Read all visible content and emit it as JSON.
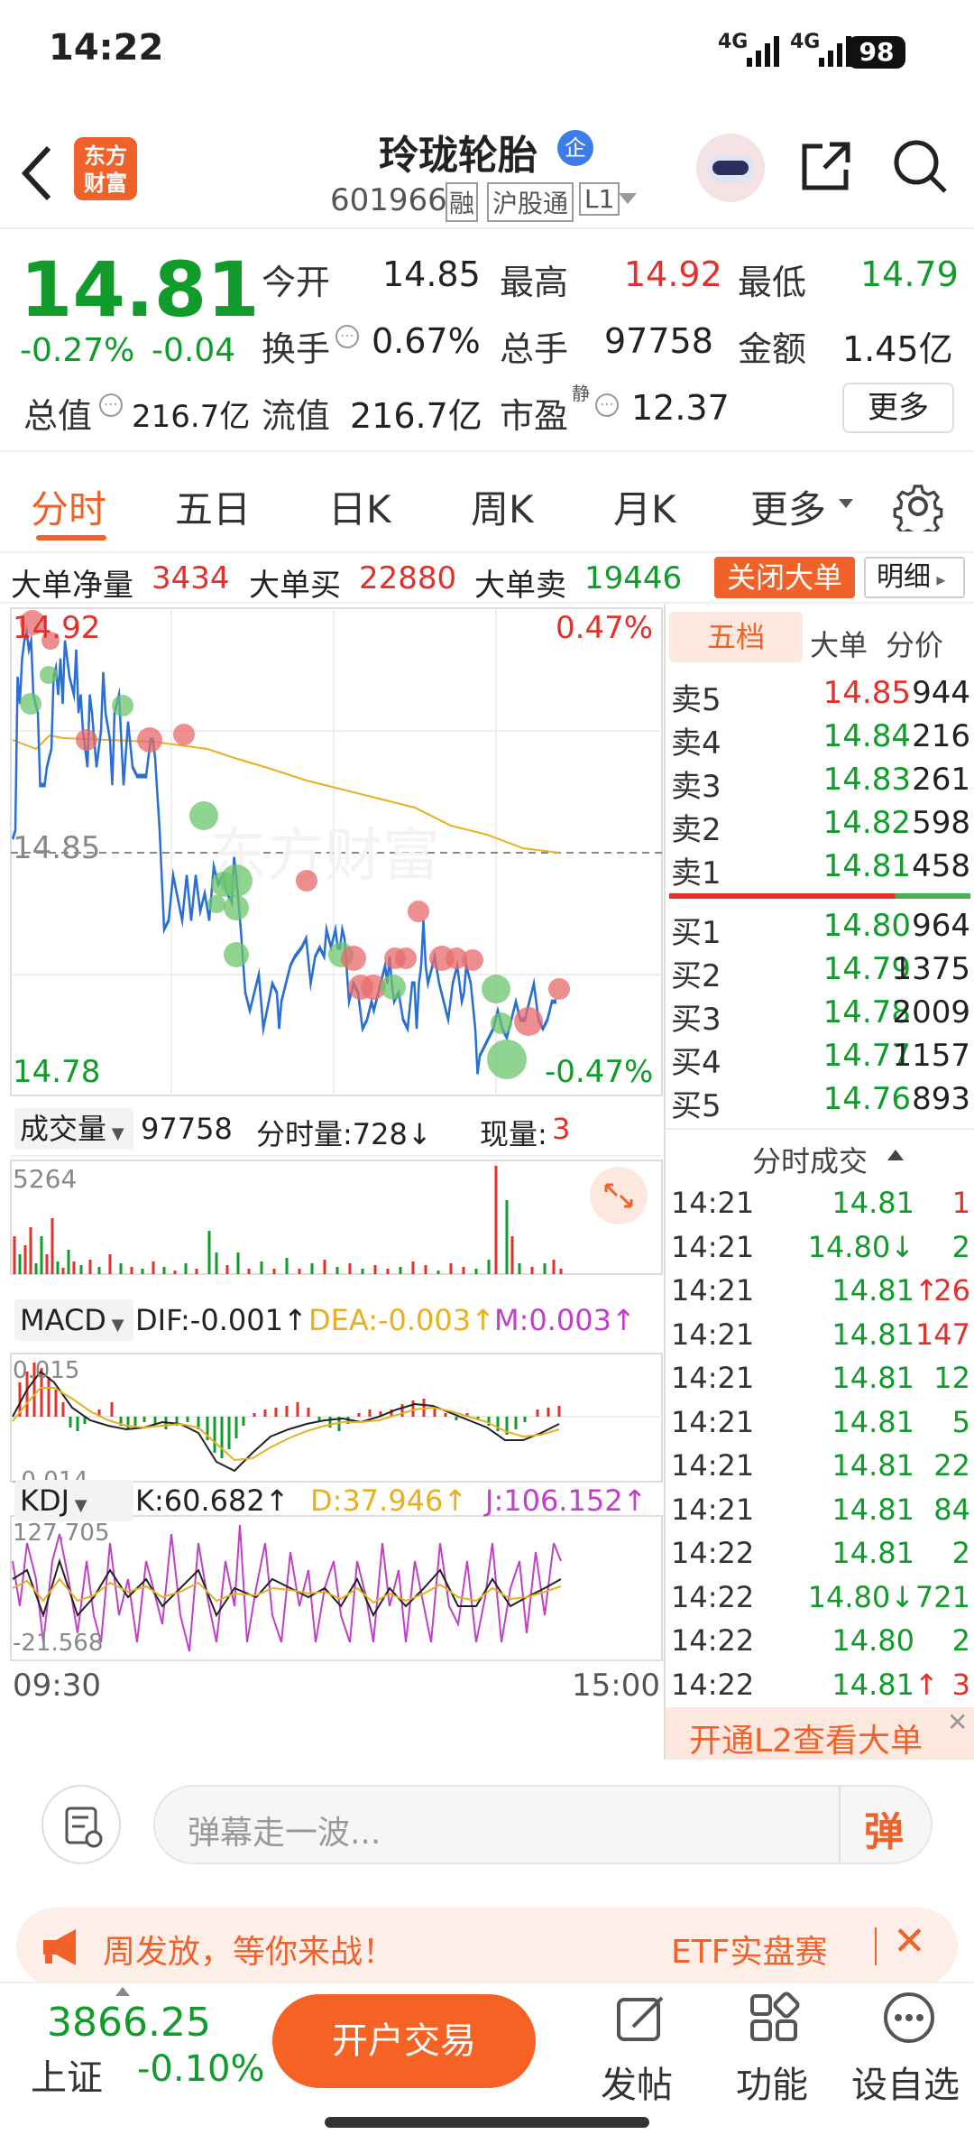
{
  "status": {
    "time": "14:22",
    "signal1": "4G",
    "signal2": "4G",
    "battery": "98"
  },
  "header": {
    "title": "玲珑轮胎",
    "badge": "企",
    "code": "601966",
    "tag1": "融",
    "tag2": "沪股通",
    "tag3": "L1"
  },
  "quote": {
    "price": "14.81",
    "change_pct": "-0.27%",
    "change": "-0.04",
    "open_label": "今开",
    "open": "14.85",
    "high_label": "最高",
    "high": "14.92",
    "low_label": "最低",
    "low": "14.79",
    "turnover_label": "换手",
    "turnover": "0.67%",
    "volume_label": "总手",
    "volume": "97758",
    "amount_label": "金额",
    "amount": "1.45亿",
    "mktcap_label": "总值",
    "mktcap": "216.7亿",
    "float_label": "流值",
    "float": "216.7亿",
    "pe_label": "市盈",
    "pe_sup": "静",
    "pe": "12.37",
    "more_button": "更多"
  },
  "tabs": {
    "t1": "分时",
    "t2": "五日",
    "t3": "日K",
    "t4": "周K",
    "t5": "月K",
    "t6": "更多"
  },
  "bigorder": {
    "net_label": "大单净量",
    "net": "3434",
    "buy_label": "大单买",
    "buy": "22880",
    "sell_label": "大单卖",
    "sell": "19446",
    "close_button": "关闭大单",
    "detail_button": "明细"
  },
  "chart": {
    "high_price": "14.92",
    "high_pct": "0.47%",
    "mid_price": "14.85",
    "low_price": "14.78",
    "low_pct": "-0.47%",
    "vol_label": "成交量",
    "vol_total": "97758",
    "vol_min_label": "分时量:728↓",
    "vol_now_label": "现量:",
    "vol_now": "3",
    "vol_max": "5264",
    "macd_label": "MACD",
    "dif": "DIF:-0.001↑",
    "dea": "DEA:-0.003↑",
    "m": "M:0.003↑",
    "macd_top": "0.015",
    "macd_bottom": "-0.014",
    "kdj_label": "KDJ",
    "k": "K:60.682↑",
    "d": "D:37.946↑",
    "j": "J:106.152↑",
    "kdj_top": "127.705",
    "kdj_bottom": "-21.568",
    "time_start": "09:30",
    "time_end": "15:00",
    "watermark": "东方财富"
  },
  "orderbook": {
    "tab1": "五档",
    "tab2": "大单",
    "tab3": "分价",
    "asks": [
      {
        "label": "卖5",
        "price": "14.85",
        "vol": "944"
      },
      {
        "label": "卖4",
        "price": "14.84",
        "vol": "216"
      },
      {
        "label": "卖3",
        "price": "14.83",
        "vol": "261"
      },
      {
        "label": "卖2",
        "price": "14.82",
        "vol": "598"
      },
      {
        "label": "卖1",
        "price": "14.81",
        "vol": "458"
      }
    ],
    "bids": [
      {
        "label": "买1",
        "price": "14.80",
        "vol": "964"
      },
      {
        "label": "买2",
        "price": "14.79",
        "vol": "1375"
      },
      {
        "label": "买3",
        "price": "14.78",
        "vol": "2009"
      },
      {
        "label": "买4",
        "price": "14.77",
        "vol": "1157"
      },
      {
        "label": "买5",
        "price": "14.76",
        "vol": "893"
      }
    ]
  },
  "trades": {
    "title": "分时成交",
    "rows": [
      {
        "time": "14:21",
        "price": "14.81",
        "vol": "1"
      },
      {
        "time": "14:21",
        "price": "14.80↓",
        "vol": "2"
      },
      {
        "time": "14:21",
        "price": "14.81↑",
        "vol": "26"
      },
      {
        "time": "14:21",
        "price": "14.81",
        "vol": "147"
      },
      {
        "time": "14:21",
        "price": "14.81",
        "vol": "12"
      },
      {
        "time": "14:21",
        "price": "14.81",
        "vol": "5"
      },
      {
        "time": "14:21",
        "price": "14.81",
        "vol": "22"
      },
      {
        "time": "14:21",
        "price": "14.81",
        "vol": "84"
      },
      {
        "time": "14:22",
        "price": "14.81",
        "vol": "2"
      },
      {
        "time": "14:22",
        "price": "14.80↓",
        "vol": "721"
      },
      {
        "time": "14:22",
        "price": "14.80",
        "vol": "2"
      },
      {
        "time": "14:22",
        "price": "14.81↑",
        "vol": "3"
      }
    ],
    "l2_promo": "开通L2查看大单"
  },
  "comment": {
    "placeholder": "弹幕走一波...",
    "danmu_label": "弹"
  },
  "banner": {
    "text": "周发放，等你来战！",
    "right_text": "ETF实盘赛"
  },
  "bottom": {
    "index_value": "3866.25",
    "index_name": "上证",
    "index_change": "-0.10%",
    "trade_button": "开户交易",
    "post": "发帖",
    "func": "功能",
    "watch": "设自选"
  }
}
